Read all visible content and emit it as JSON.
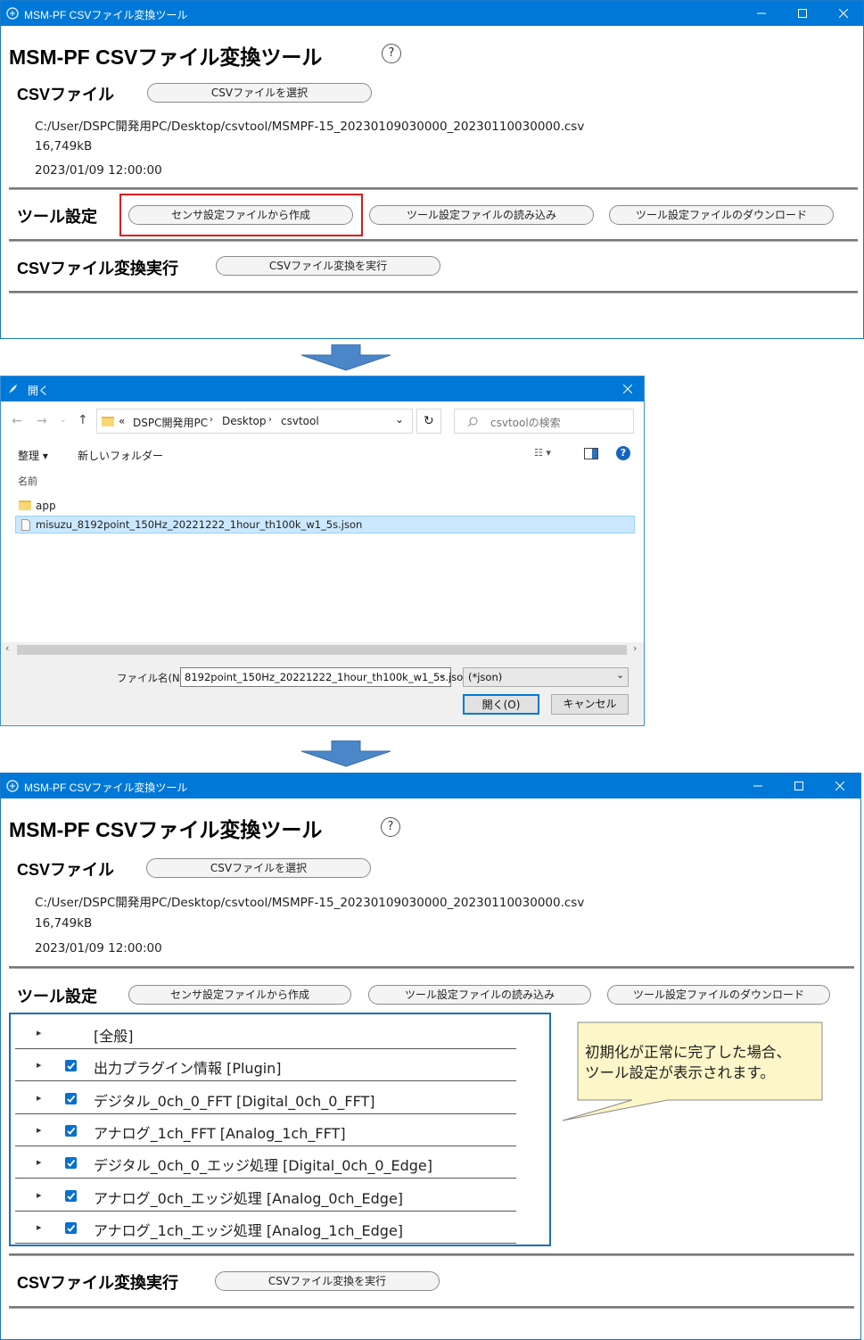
{
  "app": {
    "window_title": "MSM-PF CSVファイル変換ツール",
    "heading": "MSM-PF CSVファイル変換ツール",
    "help_glyph": "?",
    "csv_section_label": "CSVファイル",
    "select_csv_button": "CSVファイルを選択",
    "file_path": "C:/User/DSPC開発用PC/Desktop/csvtool/MSMPF-15_20230109030000_20230110030000.csv",
    "file_size": "16,749kB",
    "file_date": "2023/01/09 12:00:00",
    "tool_section_label": "ツール設定",
    "create_from_sensor_button": "センサ設定ファイルから作成",
    "load_tool_settings_button": "ツール設定ファイルの読み込み",
    "download_tool_settings_button": "ツール設定ファイルのダウンロード",
    "convert_section_label": "CSVファイル変換実行",
    "convert_button": "CSVファイル変換を実行"
  },
  "dialog": {
    "title": "開く",
    "breadcrumb": [
      "DSPC開発用PC",
      "Desktop",
      "csvtool"
    ],
    "breadcrumb_prefix": "«",
    "search_placeholder": "csvtoolの検索",
    "organize_label": "整理 ▾",
    "new_folder_label": "新しいフォルダー",
    "column_name": "名前",
    "items": [
      {
        "name": "app",
        "type": "folder"
      },
      {
        "name": "misuzu_8192point_150Hz_20221222_1hour_th100k_w1_5s.json",
        "type": "file",
        "selected": true
      }
    ],
    "filename_label": "ファイル名(N):",
    "filename_value": "8192point_150Hz_20221222_1hour_th100k_w1_5s.json",
    "filter_value": "(*json)",
    "open_button": "開く(O)",
    "cancel_button": "キャンセル"
  },
  "tree": {
    "items": [
      {
        "label": "[全般]",
        "checked": false
      },
      {
        "label": "出力プラグイン情報 [Plugin]",
        "checked": true
      },
      {
        "label": "デジタル_0ch_0_FFT [Digital_0ch_0_FFT]",
        "checked": true
      },
      {
        "label": "アナログ_1ch_FFT [Analog_1ch_FFT]",
        "checked": true
      },
      {
        "label": "デジタル_0ch_0_エッジ処理 [Digital_0ch_0_Edge]",
        "checked": true
      },
      {
        "label": "アナログ_0ch_エッジ処理 [Analog_0ch_Edge]",
        "checked": true
      },
      {
        "label": "アナログ_1ch_エッジ処理 [Analog_1ch_Edge]",
        "checked": true
      }
    ]
  },
  "callout": {
    "line1": "初期化が正常に完了した場合、",
    "line2": "ツール設定が表示されます。"
  },
  "colors": {
    "titlebar": "#0078d7",
    "highlight_box": "#e0161c",
    "tree_border": "#1a6fb5",
    "callout_fill": "#fdf6c8",
    "arrow": "#4a86c8"
  }
}
